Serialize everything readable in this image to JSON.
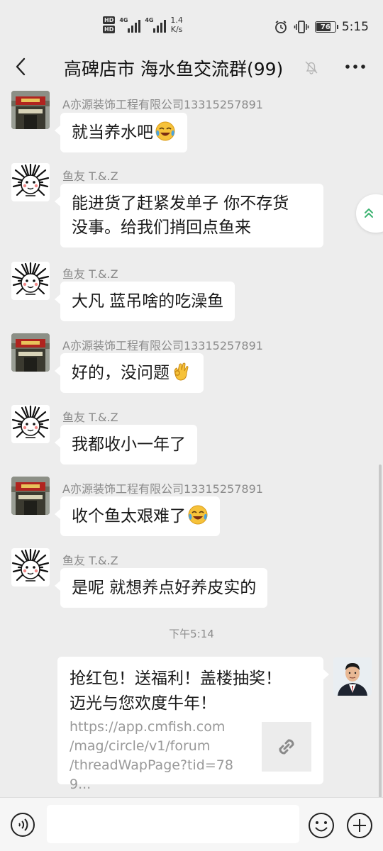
{
  "status_bar": {
    "hd_badges": [
      "HD",
      "HD"
    ],
    "signal_labels": [
      "4G",
      "4G"
    ],
    "net_speed_value": "1.4",
    "net_speed_unit": "K/s",
    "battery": "76",
    "battery_level": 0.76,
    "time": "5:15"
  },
  "header": {
    "back_icon": "chevron-left-icon",
    "title": "高碑店市 海水鱼交流群(99)",
    "mute_icon": "bell-muted-icon",
    "more_icon": "more-dots-icon"
  },
  "messages": [
    {
      "sender": "A亦源装饰工程有限公司13315257891",
      "avatar": "shop-sign-avatar",
      "text": "就当养水吧",
      "emoji": "crying-laughing-emoji"
    },
    {
      "sender": "鱼友 T.&.Z",
      "avatar": "spiky-hair-cartoon-avatar",
      "line1": "能进货了赶紧发单子 你不存货",
      "line2": "没事。给我们捎回点鱼来"
    },
    {
      "sender": "鱼友 T.&.Z",
      "avatar": "spiky-hair-cartoon-avatar",
      "text": "大凡 蓝吊啥的吃澡鱼"
    },
    {
      "sender": "A亦源装饰工程有限公司13315257891",
      "avatar": "shop-sign-avatar",
      "text": "好的，没问题",
      "emoji": "ok-hand-emoji"
    },
    {
      "sender": "鱼友 T.&.Z",
      "avatar": "spiky-hair-cartoon-avatar",
      "text": "我都收小一年了"
    },
    {
      "sender": "A亦源装饰工程有限公司13315257891",
      "avatar": "shop-sign-avatar",
      "text": "收个鱼太艰难了",
      "emoji": "crying-laughing-emoji"
    },
    {
      "sender": "鱼友 T.&.Z",
      "avatar": "spiky-hair-cartoon-avatar",
      "text": "是呢 就想养点好养皮实的"
    }
  ],
  "time_divider": "下午5:14",
  "link_card": {
    "title_line1": "抢红包！送福利！盖楼抽奖！",
    "title_line2": "迈光与您欢度牛年！",
    "url_line1": "https://app.cmfish.com",
    "url_line2": "/mag/circle/v1/forum",
    "url_line3": "/threadWapPage?tid=789...",
    "thumb_icon": "link-icon",
    "avatar": "man-in-suit-avatar"
  },
  "input_bar": {
    "voice_icon": "voice-icon",
    "text_value": "",
    "emoji_icon": "smiley-icon",
    "plus_icon": "plus-circle-icon"
  },
  "float_button_icon": "double-chevron-up-icon",
  "colors": {
    "background": "#ededed",
    "bubble": "#ffffff",
    "sender": "#8a8a8a",
    "float_chevron": "#3cb371"
  }
}
